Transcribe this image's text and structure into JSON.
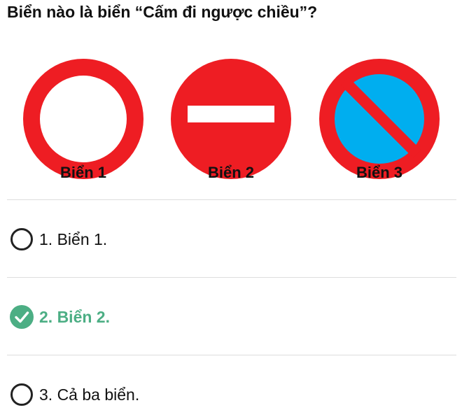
{
  "question": {
    "text": "Biển nào là biển “Cấm đi ngược chiều”?"
  },
  "signs": [
    {
      "label": "Biển 1",
      "icon": "no-vehicles-sign-icon"
    },
    {
      "label": "Biển 2",
      "icon": "no-entry-sign-icon"
    },
    {
      "label": "Biển 3",
      "icon": "no-parking-sign-icon"
    }
  ],
  "answers": [
    {
      "label": "1. Biển 1.",
      "state": "unselected"
    },
    {
      "label": "2. Biển 2.",
      "state": "correct"
    },
    {
      "label": "3. Cả ba biển.",
      "state": "unselected"
    }
  ],
  "colors": {
    "sign_red": "#ee1d23",
    "sign_blue": "#00aeef",
    "correct_green": "#4cae84",
    "radio_outline": "#222222"
  }
}
